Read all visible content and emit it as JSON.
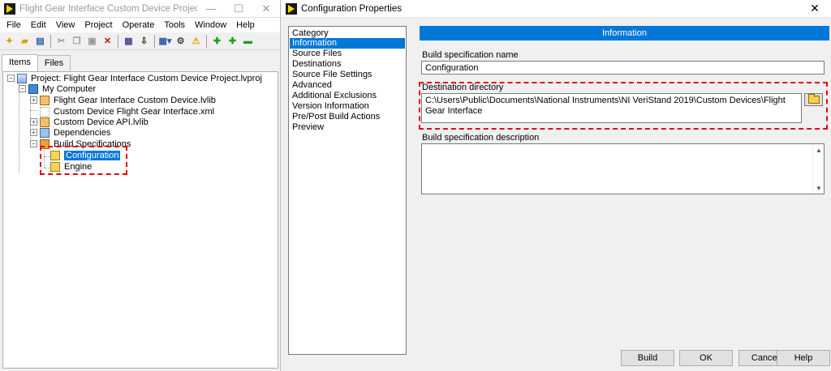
{
  "project_window": {
    "title": "Flight Gear Interface Custom Device Project.lvpr...",
    "controls": [
      "—",
      "☐",
      "✕"
    ],
    "menu": [
      "File",
      "Edit",
      "View",
      "Project",
      "Operate",
      "Tools",
      "Window",
      "Help"
    ],
    "tabs": [
      "Items",
      "Files"
    ],
    "tree": {
      "project": "Project: Flight Gear Interface Custom Device Project.lvproj",
      "my_computer": "My Computer",
      "items": [
        "Flight Gear Interface Custom Device.lvlib",
        "Custom Device Flight Gear Interface.xml",
        "Custom Device API.lvlib",
        "Dependencies",
        "Build Specifications"
      ],
      "build_specs": [
        "Configuration",
        "Engine"
      ]
    }
  },
  "config_window": {
    "title": "Configuration Properties",
    "close": "✕",
    "category_header": "Category",
    "categories": [
      "Information",
      "Source Files",
      "Destinations",
      "Source File Settings",
      "Advanced",
      "Additional Exclusions",
      "Version Information",
      "Pre/Post Build Actions",
      "Preview"
    ],
    "section_header": "Information",
    "build_spec_name_label": "Build specification name",
    "build_spec_name_value": "Configuration",
    "dest_dir_label": "Destination directory",
    "dest_dir_value": "C:\\Users\\Public\\Documents\\National Instruments\\NI VeriStand 2019\\Custom Devices\\Flight Gear Interface",
    "desc_label": "Build specification description",
    "desc_value": "",
    "buttons": {
      "build": "Build",
      "ok": "OK",
      "cancel": "Cancel",
      "help": "Help"
    }
  }
}
